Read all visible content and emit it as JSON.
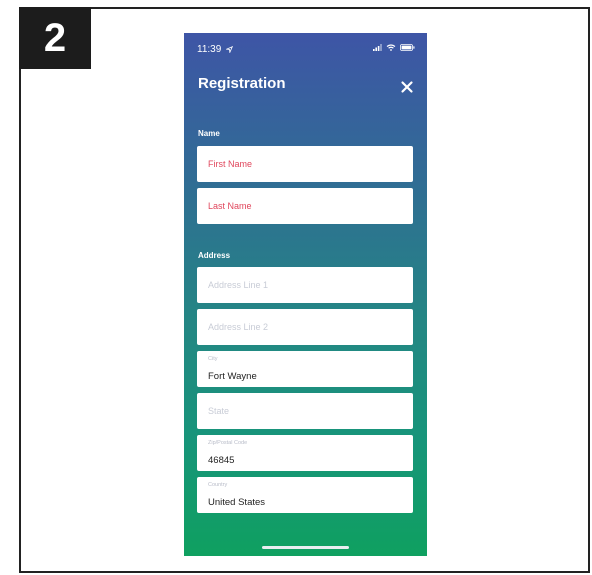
{
  "step": {
    "number": "2"
  },
  "status_bar": {
    "time": "11:39"
  },
  "header": {
    "title": "Registration"
  },
  "sections": {
    "name_label": "Name",
    "address_label": "Address"
  },
  "fields": {
    "first_name": {
      "placeholder": "First Name",
      "required": true
    },
    "last_name": {
      "placeholder": "Last Name",
      "required": true
    },
    "address_line_1": {
      "placeholder": "Address Line 1"
    },
    "address_line_2": {
      "placeholder": "Address Line 2"
    },
    "city": {
      "label": "City",
      "value": "Fort Wayne"
    },
    "state": {
      "placeholder": "State"
    },
    "zip": {
      "label": "Zip/Postal Code",
      "value": "46845"
    },
    "country": {
      "label": "Country",
      "value": "United States"
    }
  },
  "colors": {
    "gradient_top": "#3e55a6",
    "gradient_bottom": "#0fa060",
    "required_placeholder": "#e0465c"
  },
  "icons": [
    "location-arrow-icon",
    "signal-icon",
    "wifi-icon",
    "battery-icon",
    "close-icon"
  ]
}
